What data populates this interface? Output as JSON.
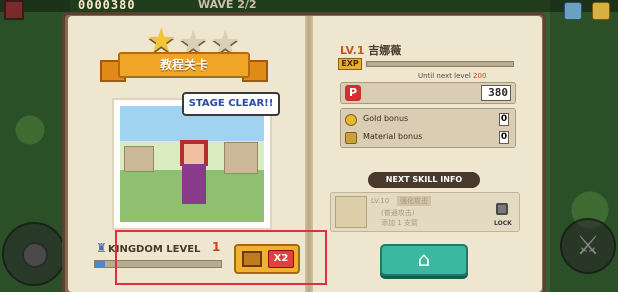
{
  "hud": {
    "score": "0000380",
    "wave": "WAVE 2/2"
  },
  "stars": {
    "filled": 1,
    "total": 3
  },
  "stage": {
    "ribbon_title": "教程关卡",
    "speech": "STAGE CLEAR!!"
  },
  "kingdom": {
    "label": "KINGDOM LEVEL",
    "value": "1",
    "progress": 0.08,
    "bonus_multiplier": "X2"
  },
  "hero": {
    "level": "LV.1",
    "name": "吉娜薇",
    "exp_badge": "EXP",
    "exp_progress": 0,
    "next_level_label": "Until next level",
    "next_level_value": "200",
    "points_icon": "P",
    "points": "380",
    "gold_bonus_label": "Gold bonus",
    "gold_bonus_value": "0",
    "material_bonus_label": "Material bonus",
    "material_bonus_value": "0"
  },
  "skill": {
    "header": "NEXT SKILL INFO",
    "level_text": "LV.10",
    "name": "强化攻击",
    "desc1": "(普通攻击)",
    "desc2": "添加 1 支箭",
    "lock_label": "LOCK"
  },
  "icons": {
    "star": "star-icon",
    "home": "home-icon",
    "lock": "lock-icon",
    "chest": "treasure-chest-icon",
    "coin": "coin-icon",
    "material": "material-icon"
  },
  "colors": {
    "accent_orange": "#f0a526",
    "home_teal": "#3ab8a0",
    "highlight_red": "#e03040",
    "page_cream": "#efe6cf"
  }
}
